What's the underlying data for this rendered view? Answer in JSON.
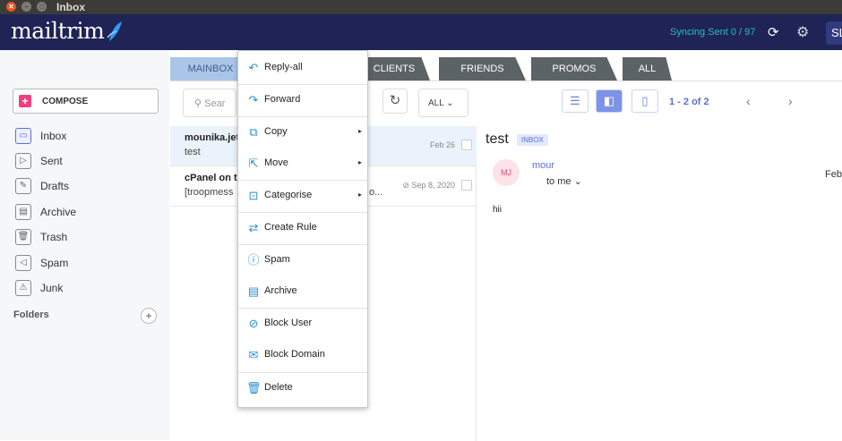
{
  "window": {
    "title": "Inbox"
  },
  "app": {
    "logo": "mailtrim",
    "sync_text": "Syncing Sent 0 / 97",
    "user_initials": "SL"
  },
  "sidebar": {
    "compose_label": "COMPOSE",
    "items": [
      {
        "label": "Inbox",
        "icon": "inbox-icon"
      },
      {
        "label": "Sent",
        "icon": "send-icon"
      },
      {
        "label": "Drafts",
        "icon": "drafts-icon"
      },
      {
        "label": "Archive",
        "icon": "archive-icon"
      },
      {
        "label": "Trash",
        "icon": "trash-icon"
      },
      {
        "label": "Spam",
        "icon": "spam-icon"
      },
      {
        "label": "Junk",
        "icon": "junk-icon"
      }
    ],
    "folders_label": "Folders"
  },
  "tabs": [
    {
      "label": "MAINBOX"
    },
    {
      "label": "CLIENTS"
    },
    {
      "label": "FRIENDS"
    },
    {
      "label": "PROMOS"
    },
    {
      "label": "ALL"
    }
  ],
  "toolbar": {
    "search_placeholder": "Sear",
    "filter_value": "ALL",
    "pager_text": "1 - 2  of  2"
  },
  "mails": [
    {
      "from": "mounika.jet",
      "subject": "test",
      "date": "Feb 26"
    },
    {
      "from": "cPanel on t",
      "subject": "[troopmess",
      "date": "Sep 8, 2020",
      "snippet": "o..."
    }
  ],
  "reader": {
    "subject": "test",
    "badge": "INBOX",
    "avatar": "MJ",
    "from": "mour",
    "to": "to me",
    "date": "Feb",
    "body": "hii"
  },
  "context_menu": [
    {
      "label": "Reply-all",
      "icon": "reply-all-icon"
    },
    {
      "label": "Forward",
      "icon": "forward-icon"
    },
    {
      "label": "Copy",
      "icon": "copy-icon",
      "submenu": true
    },
    {
      "label": "Move",
      "icon": "move-icon",
      "submenu": true
    },
    {
      "label": "Categorise",
      "icon": "categorise-icon",
      "submenu": true
    },
    {
      "label": "Create Rule",
      "icon": "create-rule-icon"
    },
    {
      "label": "Spam",
      "icon": "spam-icon"
    },
    {
      "label": "Archive",
      "icon": "archive-icon"
    },
    {
      "label": "Block User",
      "icon": "block-user-icon"
    },
    {
      "label": "Block Domain",
      "icon": "block-domain-icon"
    },
    {
      "label": "Delete",
      "icon": "delete-icon"
    }
  ],
  "colors": {
    "appbar": "#1f2356",
    "accent": "#5a6fd6",
    "compose": "#ee3f80",
    "sync": "#27c1b3",
    "arrow": "#3d9a93"
  }
}
